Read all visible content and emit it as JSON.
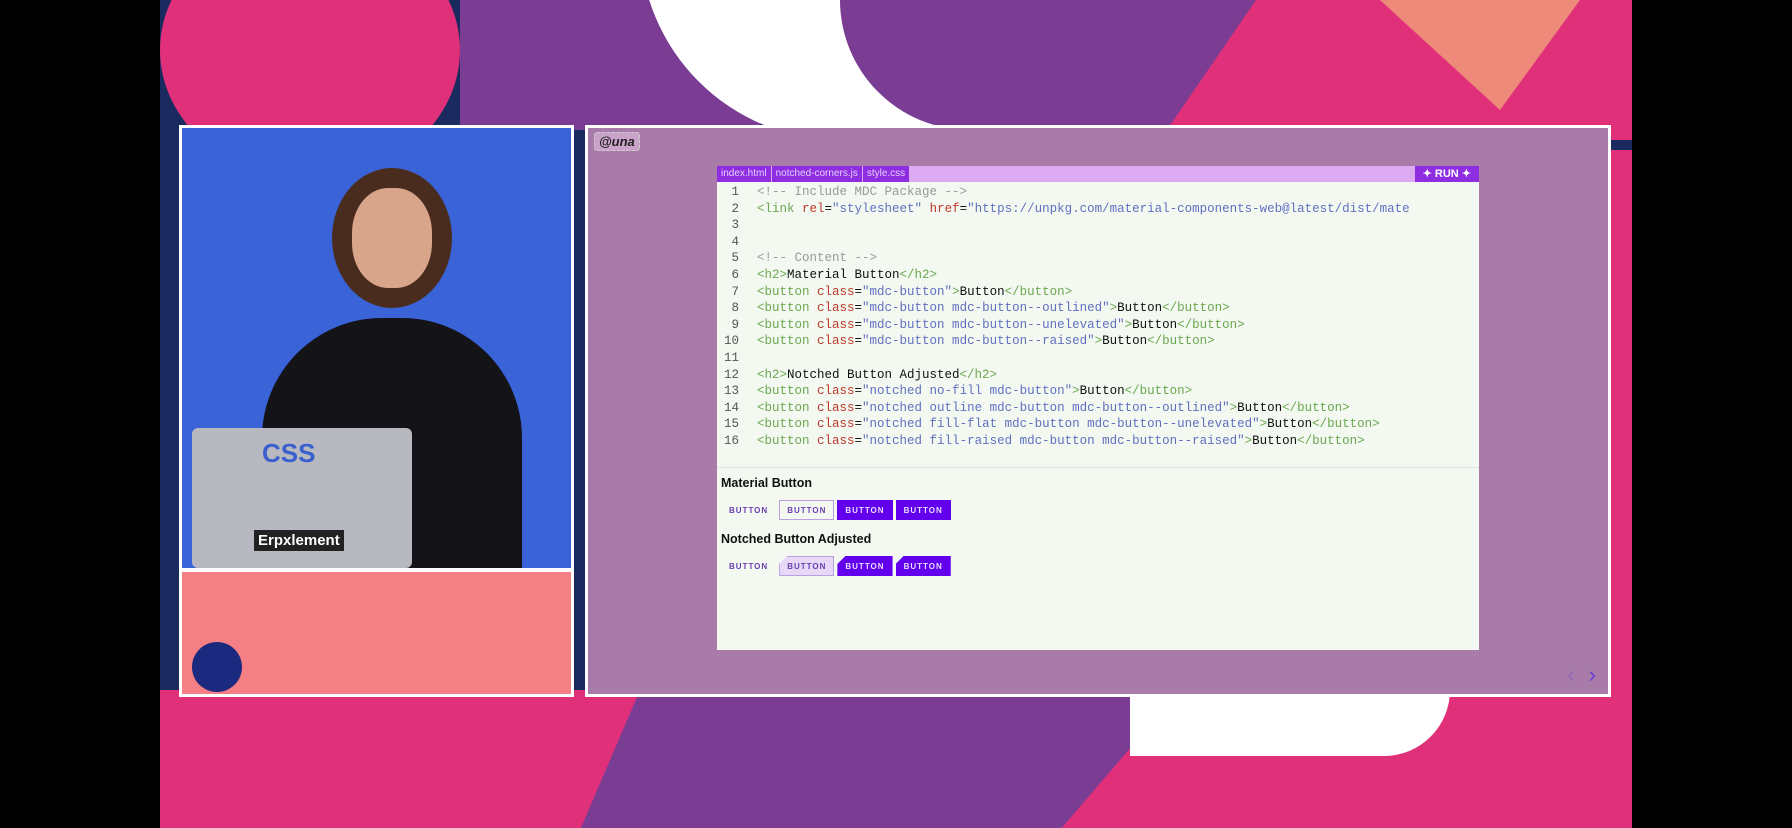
{
  "slide": {
    "handle": "@una",
    "tabs": [
      "index.html",
      "notched-corners.js",
      "style.css"
    ],
    "run_label": "✦ RUN ✦",
    "code": [
      {
        "n": "1",
        "parts": [
          [
            "c",
            "<!-- Include MDC Package -->"
          ]
        ]
      },
      {
        "n": "2",
        "parts": [
          [
            "t",
            "<link "
          ],
          [
            "a",
            "rel"
          ],
          [
            "x",
            "="
          ],
          [
            "s",
            "\"stylesheet\" "
          ],
          [
            "a",
            "href"
          ],
          [
            "x",
            "="
          ],
          [
            "s",
            "\"https://unpkg.com/material-components-web@latest/dist/mate"
          ]
        ]
      },
      {
        "n": "3",
        "parts": []
      },
      {
        "n": "4",
        "parts": []
      },
      {
        "n": "5",
        "parts": [
          [
            "c",
            "<!-- Content -->"
          ]
        ]
      },
      {
        "n": "6",
        "parts": [
          [
            "t",
            "<h2>"
          ],
          [
            "x",
            "Material Button"
          ],
          [
            "t",
            "</h2>"
          ]
        ]
      },
      {
        "n": "7",
        "parts": [
          [
            "t",
            "<button "
          ],
          [
            "a",
            "class"
          ],
          [
            "x",
            "="
          ],
          [
            "s",
            "\"mdc-button\""
          ],
          [
            "t",
            ">"
          ],
          [
            "x",
            "Button"
          ],
          [
            "t",
            "</button>"
          ]
        ]
      },
      {
        "n": "8",
        "parts": [
          [
            "t",
            "<button "
          ],
          [
            "a",
            "class"
          ],
          [
            "x",
            "="
          ],
          [
            "s",
            "\"mdc-button mdc-button--outlined\""
          ],
          [
            "t",
            ">"
          ],
          [
            "x",
            "Button"
          ],
          [
            "t",
            "</button>"
          ]
        ]
      },
      {
        "n": "9",
        "parts": [
          [
            "t",
            "<button "
          ],
          [
            "a",
            "class"
          ],
          [
            "x",
            "="
          ],
          [
            "s",
            "\"mdc-button mdc-button--unelevated\""
          ],
          [
            "t",
            ">"
          ],
          [
            "x",
            "Button"
          ],
          [
            "t",
            "</button>"
          ]
        ]
      },
      {
        "n": "10",
        "parts": [
          [
            "t",
            "<button "
          ],
          [
            "a",
            "class"
          ],
          [
            "x",
            "="
          ],
          [
            "s",
            "\"mdc-button mdc-button--raised\""
          ],
          [
            "t",
            ">"
          ],
          [
            "x",
            "Button"
          ],
          [
            "t",
            "</button>"
          ]
        ]
      },
      {
        "n": "11",
        "parts": []
      },
      {
        "n": "12",
        "parts": [
          [
            "t",
            "<h2>"
          ],
          [
            "x",
            "Notched Button Adjusted"
          ],
          [
            "t",
            "</h2>"
          ]
        ]
      },
      {
        "n": "13",
        "parts": [
          [
            "t",
            "<button "
          ],
          [
            "a",
            "class"
          ],
          [
            "x",
            "="
          ],
          [
            "s",
            "\"notched no-fill mdc-button\""
          ],
          [
            "t",
            ">"
          ],
          [
            "x",
            "Button"
          ],
          [
            "t",
            "</button>"
          ]
        ]
      },
      {
        "n": "14",
        "parts": [
          [
            "t",
            "<button "
          ],
          [
            "a",
            "class"
          ],
          [
            "x",
            "="
          ],
          [
            "s",
            "\"notched outline mdc-button mdc-button--outlined\""
          ],
          [
            "t",
            ">"
          ],
          [
            "x",
            "Button"
          ],
          [
            "t",
            "</button>"
          ]
        ]
      },
      {
        "n": "15",
        "parts": [
          [
            "t",
            "<button "
          ],
          [
            "a",
            "class"
          ],
          [
            "x",
            "="
          ],
          [
            "s",
            "\"notched fill-flat mdc-button mdc-button--unelevated\""
          ],
          [
            "t",
            ">"
          ],
          [
            "x",
            "Button"
          ],
          [
            "t",
            "</button>"
          ]
        ]
      },
      {
        "n": "16",
        "parts": [
          [
            "t",
            "<button "
          ],
          [
            "a",
            "class"
          ],
          [
            "x",
            "="
          ],
          [
            "s",
            "\"notched fill-raised mdc-button mdc-button--raised\""
          ],
          [
            "t",
            ">"
          ],
          [
            "x",
            "Button"
          ],
          [
            "t",
            "</button>"
          ]
        ]
      }
    ],
    "preview": {
      "heading1": "Material Button",
      "heading2": "Notched Button Adjusted",
      "button_label": "BUTTON"
    },
    "nav": {
      "prev": "‹",
      "next": "›"
    }
  },
  "video": {
    "laptop_sticker": "Erpxlement",
    "css_sticker": "CSS"
  },
  "colors": {
    "accent": "#6200ee",
    "slide_bg": "#a97ba9",
    "tab_bar": "#dcaaf0"
  }
}
